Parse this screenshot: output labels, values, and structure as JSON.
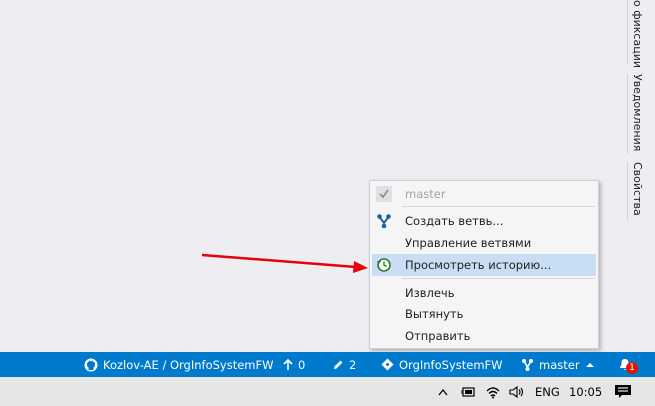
{
  "side_tabs": [
    {
      "label": "о фиксации"
    },
    {
      "label": "Уведомления"
    },
    {
      "label": "Свойства"
    }
  ],
  "menu": {
    "items": [
      {
        "label": "master",
        "icon": "check-icon",
        "disabled": true
      },
      {
        "label": "Создать ветвь...",
        "icon": "branch-icon"
      },
      {
        "label": "Управление ветвями",
        "icon": ""
      },
      {
        "label": "Просмотреть историю...",
        "icon": "history-icon",
        "highlighted": true
      },
      {
        "label": "Извлечь",
        "icon": ""
      },
      {
        "label": "Вытянуть",
        "icon": ""
      },
      {
        "label": "Отправить",
        "icon": ""
      }
    ]
  },
  "statusbar": {
    "repo": "Kozlov-AE / OrgInfoSystemFW",
    "unpushed": "0",
    "changes": "2",
    "project": "OrgInfoSystemFW",
    "branch": "master",
    "notifications": "1"
  },
  "taskbar": {
    "language": "ENG",
    "time": "10:05"
  },
  "colors": {
    "statusbar": "#007acc",
    "menu_highlight": "#c9def5",
    "arrow": "#e8000b"
  }
}
